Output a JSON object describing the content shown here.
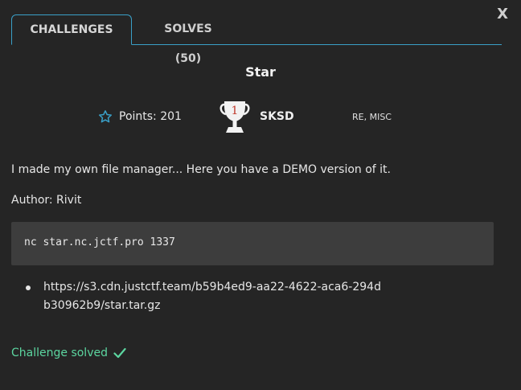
{
  "close_label": "X",
  "tabs": [
    {
      "label": "CHALLENGES",
      "active": true
    },
    {
      "label": "SOLVES (50)",
      "active": false
    }
  ],
  "challenge": {
    "title": "Star",
    "points": "Points: 201",
    "trophy_rank": "1",
    "team": "SKSD",
    "categories": "RE, MISC",
    "description": "I made my own file manager... Here you have a DEMO version of it.",
    "author": "Author: Rivit",
    "connection": "nc star.nc.jctf.pro 1337",
    "files": [
      "https://s3.cdn.justctf.team/b59b4ed9-aa22-4622-aca6-294db30962b9/star.tar.gz"
    ],
    "status": "Challenge solved"
  },
  "colors": {
    "background": "#252525",
    "accent": "#3aa0c8",
    "success": "#5cd6a0",
    "code_bg": "#3d3d3d"
  },
  "icons": [
    "star-icon",
    "trophy-icon",
    "checkmark-icon"
  ]
}
